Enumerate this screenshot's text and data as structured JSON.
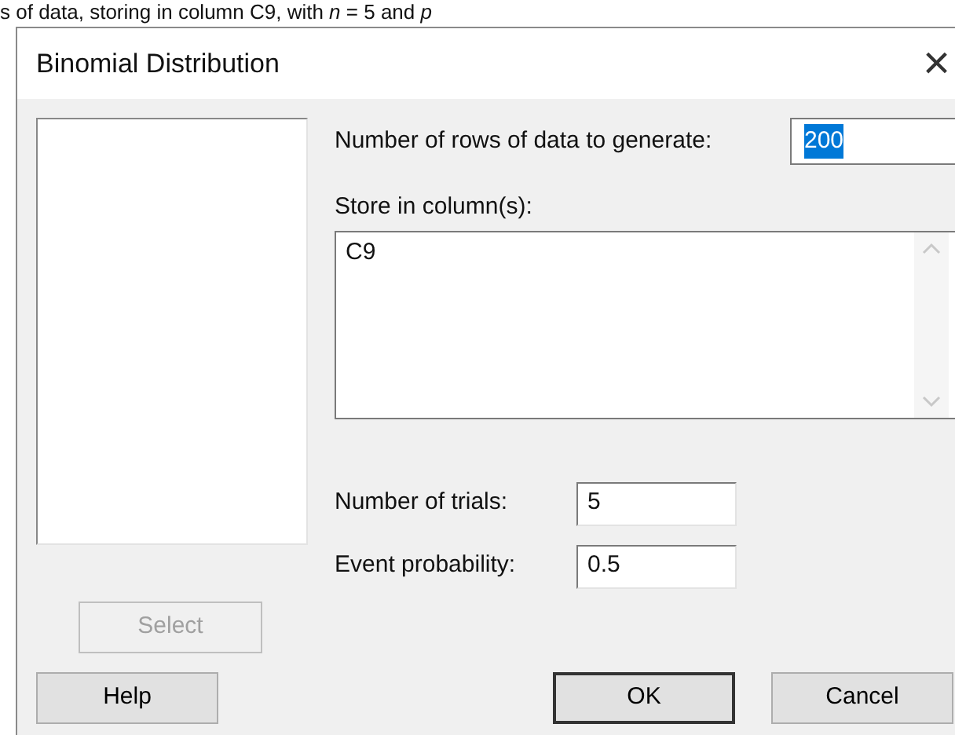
{
  "background_text": "s of data, storing in column C9, with *n* = 5 and *p*",
  "window": {
    "title": "Binomial Distribution",
    "close": "×"
  },
  "rows_field": {
    "label": "Number of rows of data to generate:",
    "value": "200",
    "selected": true
  },
  "store_field": {
    "label": "Store in column(s):",
    "value": "C9"
  },
  "trials_field": {
    "label": "Number of trials:",
    "value": "5"
  },
  "probability_field": {
    "label": "Event probability:",
    "value": "0.5"
  },
  "select_button": {
    "label": "Select",
    "disabled": true
  },
  "buttons": [
    {
      "label": "Help",
      "default": false
    },
    {
      "label": "OK",
      "default": true
    },
    {
      "label": "Cancel",
      "default": false
    }
  ]
}
